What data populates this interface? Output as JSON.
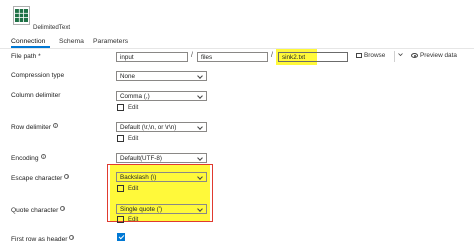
{
  "header": {
    "title": "DelimitedText",
    "icon": "excel-table-icon"
  },
  "tabs": [
    {
      "label": "Connection"
    },
    {
      "label": "Schema"
    },
    {
      "label": "Parameters"
    }
  ],
  "file_path": {
    "label": "File path",
    "required_marker": "*",
    "container": "input",
    "directory": "files",
    "file_name": "sink2.txt",
    "separator": "/",
    "browse_label": "Browse",
    "preview_label": "Preview data"
  },
  "compression_type": {
    "label": "Compression type",
    "value": "None"
  },
  "column_delimiter": {
    "label": "Column delimiter",
    "value": "Comma (,)",
    "edit_label": "Edit"
  },
  "row_delimiter": {
    "label": "Row delimiter",
    "value": "Default (\\r,\\n, or \\r\\n)",
    "edit_label": "Edit"
  },
  "encoding": {
    "label": "Encoding",
    "value": "Default(UTF-8)"
  },
  "escape_character": {
    "label": "Escape character",
    "value": "Backslash (\\)",
    "edit_label": "Edit"
  },
  "quote_character": {
    "label": "Quote character",
    "value": "Single quote (')",
    "edit_label": "Edit"
  },
  "first_row_header": {
    "label": "First row as header",
    "checked": true
  },
  "colors": {
    "accent": "#0078d4",
    "highlight": "#fff93a",
    "annotation_border": "#e03a2f"
  }
}
